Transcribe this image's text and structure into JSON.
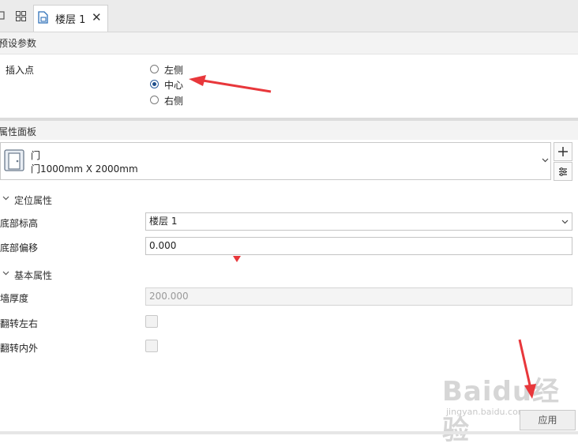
{
  "tabs": {
    "active_label": "楼层 1",
    "close_glyph": "✕"
  },
  "preset": {
    "header": "预设参数",
    "insertion_point_label": "插入点",
    "options": [
      "左侧",
      "中心",
      "右侧"
    ],
    "selected": "中心"
  },
  "properties": {
    "header": "属性面板",
    "component": {
      "name": "门",
      "spec": "门1000mm X 2000mm"
    },
    "positioning": {
      "title": "定位属性",
      "base_level_label": "底部标高",
      "base_level_value": "楼层 1",
      "base_offset_label": "底部偏移",
      "base_offset_value": "0.000"
    },
    "basic": {
      "title": "基本属性",
      "wall_thickness_label": "墙厚度",
      "wall_thickness_value": "200.000",
      "flip_lr_label": "翻转左右",
      "flip_io_label": "翻转内外"
    }
  },
  "apply_label": "应用",
  "watermark": {
    "brand": "Baidu经验",
    "url": "jingyan.baidu.com"
  },
  "colors": {
    "annotation_arrow": "#e8373b",
    "radio_selected": "#1f4f8c"
  },
  "icons": [
    "grid-icon",
    "document-icon",
    "close-icon",
    "door-icon",
    "plus-icon",
    "list-settings-icon",
    "chevron-down-icon"
  ]
}
